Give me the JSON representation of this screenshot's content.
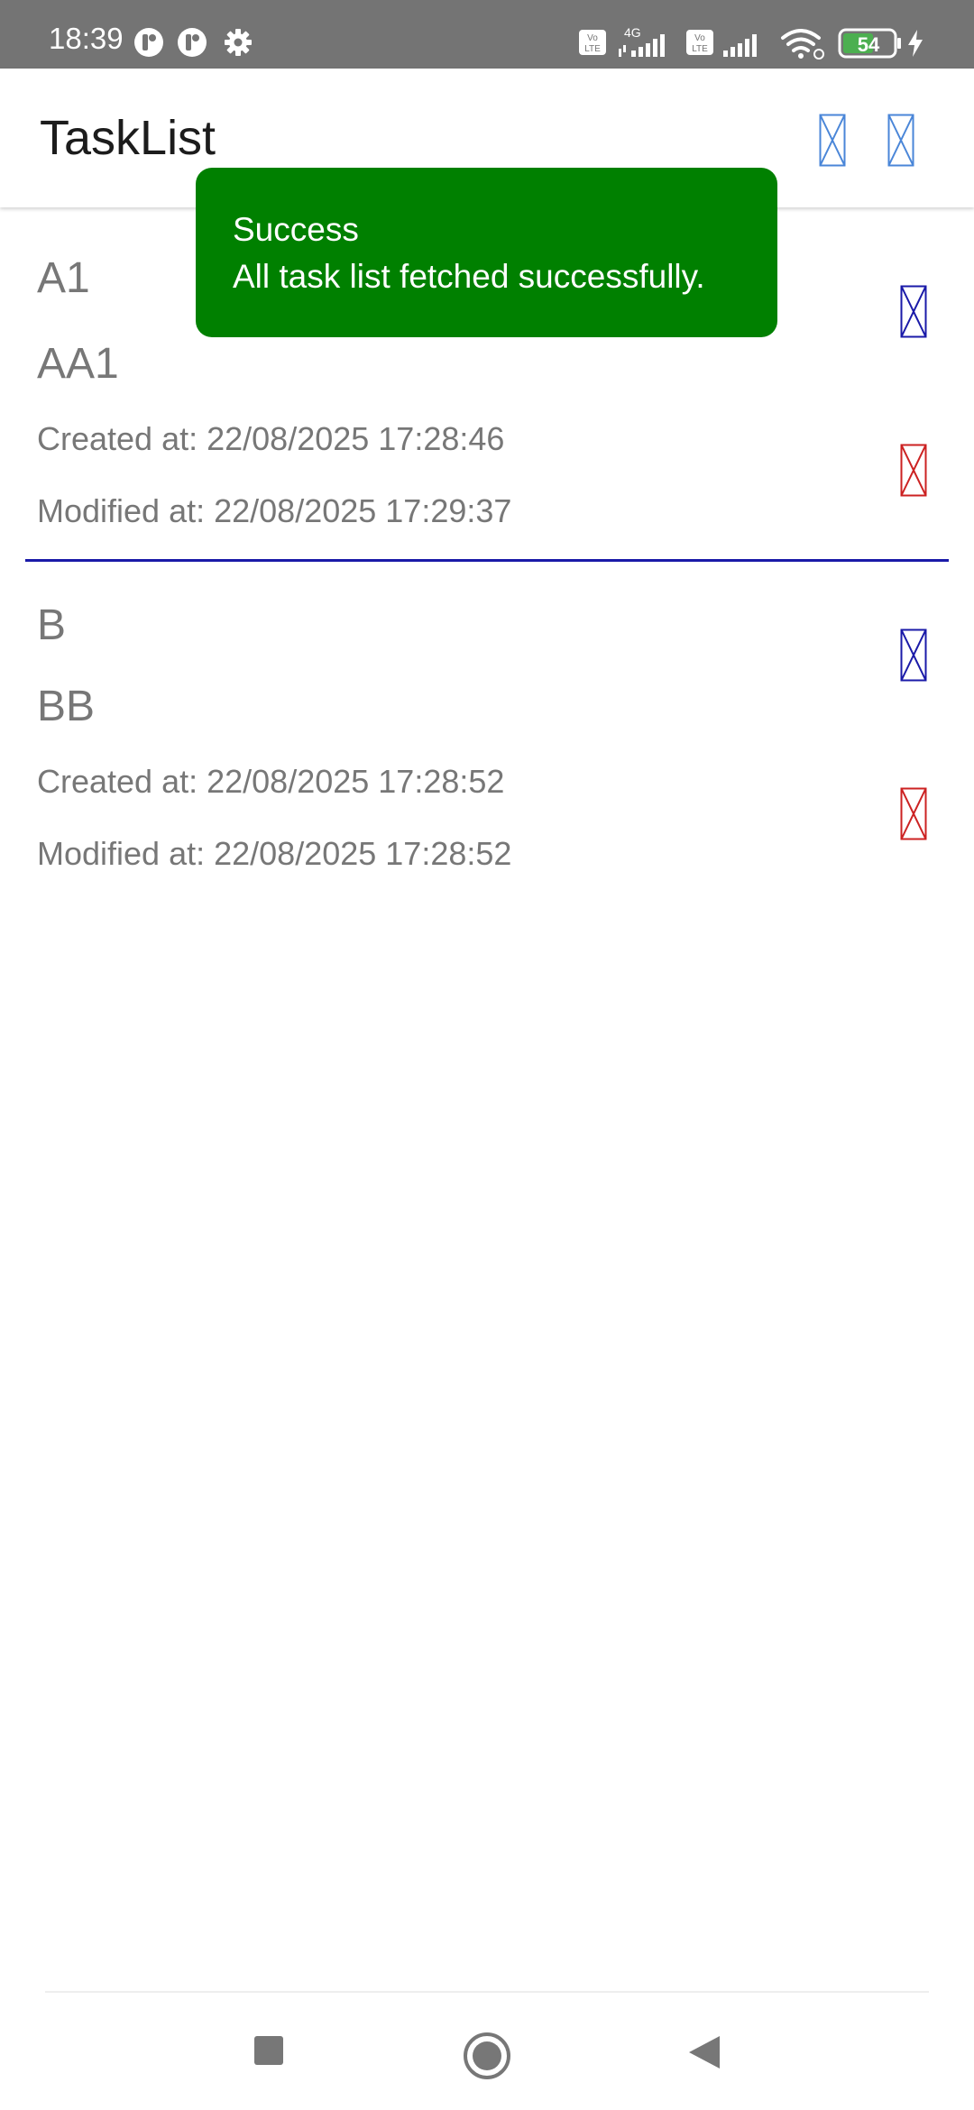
{
  "status_bar": {
    "time": "18:39",
    "network_type": "4G",
    "volte_label": "Vo LTE",
    "battery": "54",
    "icons": [
      "notification-app-icon",
      "notification-app-icon",
      "settings-gear-icon",
      "volte-icon",
      "signal-icon",
      "volte-icon",
      "signal-icon",
      "wifi-icon",
      "battery-icon",
      "charging-bolt-icon"
    ]
  },
  "app_bar": {
    "title": "TaskList",
    "actions": [
      "placeholder-image-icon",
      "placeholder-image-icon"
    ]
  },
  "toast": {
    "title": "Success",
    "message": "All task list fetched successfully.",
    "background": "#008000"
  },
  "tasks": [
    {
      "title": "A1",
      "description": "AA1",
      "created": "Created at: 22/08/2025 17:28:46",
      "modified": "Modified at: 22/08/2025 17:29:37",
      "edit_icon": "edit-placeholder-icon",
      "delete_icon": "delete-placeholder-icon"
    },
    {
      "title": "B",
      "description": "BB",
      "created": "Created at: 22/08/2025 17:28:52",
      "modified": "Modified at: 22/08/2025 17:28:52",
      "edit_icon": "edit-placeholder-icon",
      "delete_icon": "delete-placeholder-icon"
    }
  ],
  "colors": {
    "status_bar": "#747474",
    "text_secondary": "#777777",
    "divider": "#1a1aa8",
    "edit_icon": "#1a1aa8",
    "delete_icon": "#cc2222",
    "appbar_icon": "#4a86d8"
  },
  "nav_bar": {
    "buttons": [
      "recents-square-icon",
      "home-circle-icon",
      "back-triangle-icon"
    ]
  }
}
